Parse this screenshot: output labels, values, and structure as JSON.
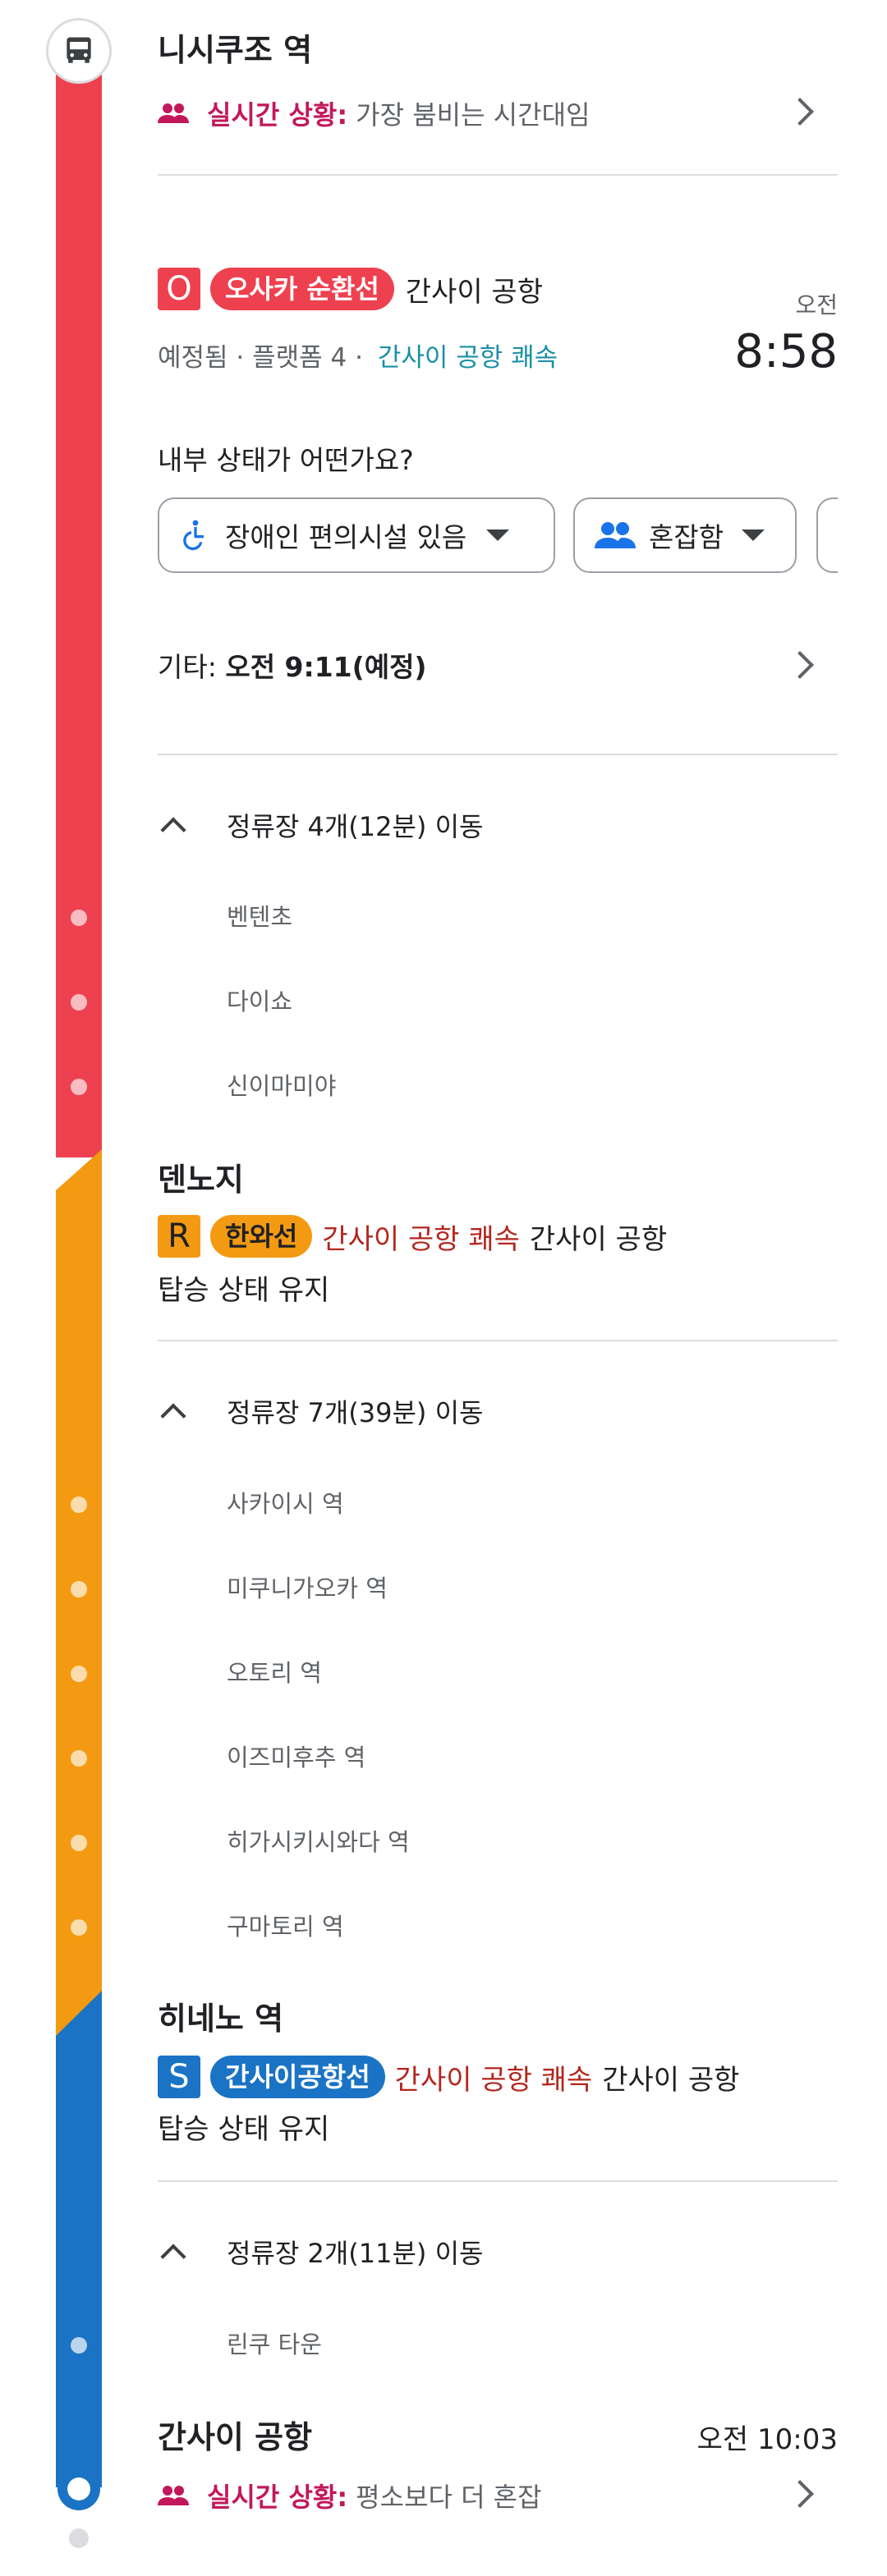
{
  "colors": {
    "osaka_loop": "#ee4150",
    "hanwa": "#f39a12",
    "kansai_airport_line": "#1a73c4",
    "crowd_magenta": "#c2185b",
    "teal": "#1a8fa5",
    "express_red": "#b3261e"
  },
  "start": {
    "station": "니시쿠조 역",
    "live_label": "실시간 상황:",
    "live_text": "가장 붐비는 시간대임",
    "icon": "bus-icon"
  },
  "leg1": {
    "line_letter": "O",
    "line_name": "오사카 순환선",
    "destination": "간사이 공항",
    "status": "예정됨 · 플랫폼 4 ·",
    "service": "간사이 공항 쾌속",
    "time_period": "오전",
    "time": "8:58",
    "question": "내부 상태가 어떤가요?",
    "chip_accessibility": "장애인 편의시설 있음",
    "chip_crowd": "혼잡함",
    "other_label": "기타:",
    "other_time": "오전 9:11(예정)",
    "stops_summary": "정류장 4개(12분) 이동",
    "stops": [
      "벤텐초",
      "다이쇼",
      "신이마미야"
    ]
  },
  "transfer1": {
    "station": "덴노지",
    "line_letter": "R",
    "line_name": "한와선",
    "service": "간사이 공항 쾌속",
    "destination": "간사이 공항",
    "note": "탑승 상태 유지",
    "stops_summary": "정류장 7개(39분) 이동",
    "stops": [
      "사카이시 역",
      "미쿠니가오카 역",
      "오토리 역",
      "이즈미후추 역",
      "히가시키시와다 역",
      "구마토리 역"
    ]
  },
  "transfer2": {
    "station": "히네노 역",
    "line_letter": "S",
    "line_name": "간사이공항선",
    "service": "간사이 공항 쾌속",
    "destination": "간사이 공항",
    "note": "탑승 상태 유지",
    "stops_summary": "정류장 2개(11분) 이동",
    "stops": [
      "린쿠 타운"
    ]
  },
  "end": {
    "station": "간사이 공항",
    "arrival": "오전 10:03",
    "live_label": "실시간 상황:",
    "live_text": "평소보다 더 혼잡"
  }
}
